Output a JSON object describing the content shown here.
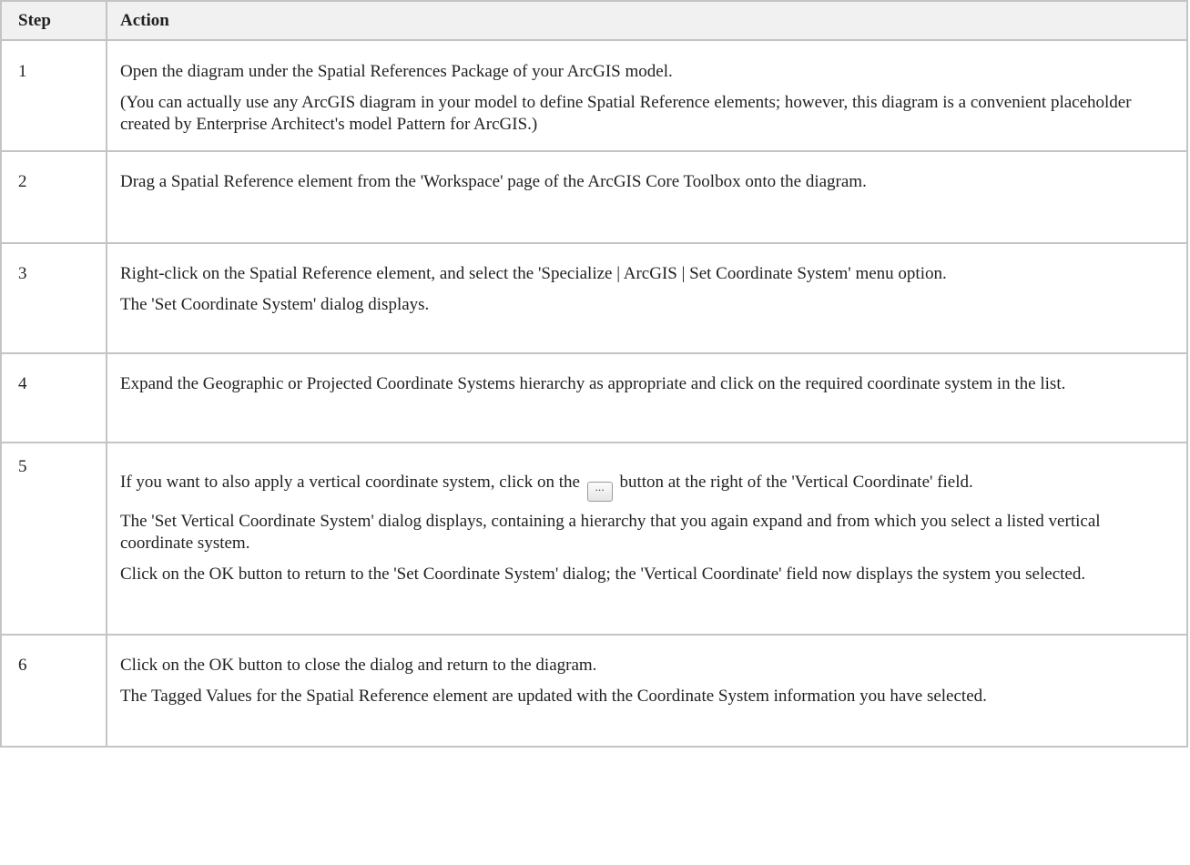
{
  "table": {
    "headers": {
      "step": "Step",
      "action": "Action"
    },
    "rows": [
      {
        "step": "1",
        "paragraphs": [
          "Open the diagram under the Spatial References Package of your ArcGIS model.",
          "(You can actually use any ArcGIS diagram in your model to define Spatial Reference elements; however, this diagram is a convenient placeholder created by Enterprise Architect's model Pattern for ArcGIS.)"
        ]
      },
      {
        "step": "2",
        "paragraphs": [
          "Drag a Spatial Reference element from the 'Workspace' page of the ArcGIS Core Toolbox onto the diagram."
        ]
      },
      {
        "step": "3",
        "paragraphs": [
          "Right-click on the Spatial Reference element, and select the 'Specialize | ArcGIS | Set Coordinate System' menu option.",
          "The 'Set Coordinate System' dialog displays."
        ]
      },
      {
        "step": "4",
        "paragraphs": [
          "Expand the Geographic or Projected Coordinate Systems hierarchy as appropriate and click on the required coordinate system in the list."
        ]
      },
      {
        "step": "5",
        "p1_before": "If you want to also apply a vertical coordinate system, click on the",
        "p1_button": "...",
        "p1_after": "button at the right of the 'Vertical Coordinate' field.",
        "paragraphs": [
          "The 'Set Vertical Coordinate System' dialog displays, containing a hierarchy that you again expand and from which you select a listed vertical coordinate system.",
          "Click on the OK button to return to the 'Set Coordinate System' dialog; the 'Vertical Coordinate' field now displays the system you selected."
        ]
      },
      {
        "step": "6",
        "paragraphs": [
          "Click on the OK button to close the dialog and return to the diagram.",
          "The Tagged Values for the Spatial Reference element are updated with the Coordinate System information you have selected."
        ]
      }
    ]
  }
}
